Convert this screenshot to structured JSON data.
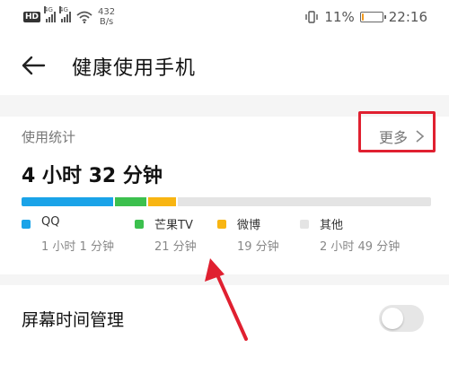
{
  "status_bar": {
    "left_badge": "HD",
    "signal1_tag": "4G",
    "signal2_tag": "4G",
    "net_speed_value": "432",
    "net_speed_unit": "B/s",
    "battery_percent": "11%",
    "battery_level": 0.11,
    "time": "22:16",
    "icons": [
      "hd-icon",
      "signal-icon",
      "signal-icon",
      "wifi-icon",
      "vibrate-icon",
      "battery-icon"
    ]
  },
  "header": {
    "back_icon": "arrow-left-icon",
    "title": "健康使用手机"
  },
  "usage": {
    "label": "使用统计",
    "more_label": "更多",
    "more_icon": "chevron-right-icon",
    "total": "4 小时 32 分钟",
    "apps": [
      {
        "name": "QQ",
        "duration": "1 小时 1 分钟",
        "minutes": 61,
        "color": "#1aa3e8"
      },
      {
        "name": "芒果TV",
        "duration": "21 分钟",
        "minutes": 21,
        "color": "#3cc04e"
      },
      {
        "name": "微博",
        "duration": "19 分钟",
        "minutes": 19,
        "color": "#f8b512"
      },
      {
        "name": "其他",
        "duration": "2 小时 49 分钟",
        "minutes": 169,
        "color": "#e4e4e4"
      }
    ]
  },
  "screen_time": {
    "label": "屏幕时间管理",
    "toggle_on": false
  },
  "annotations": {
    "highlight_color": "#e02030",
    "arrow_color": "#e02030"
  }
}
